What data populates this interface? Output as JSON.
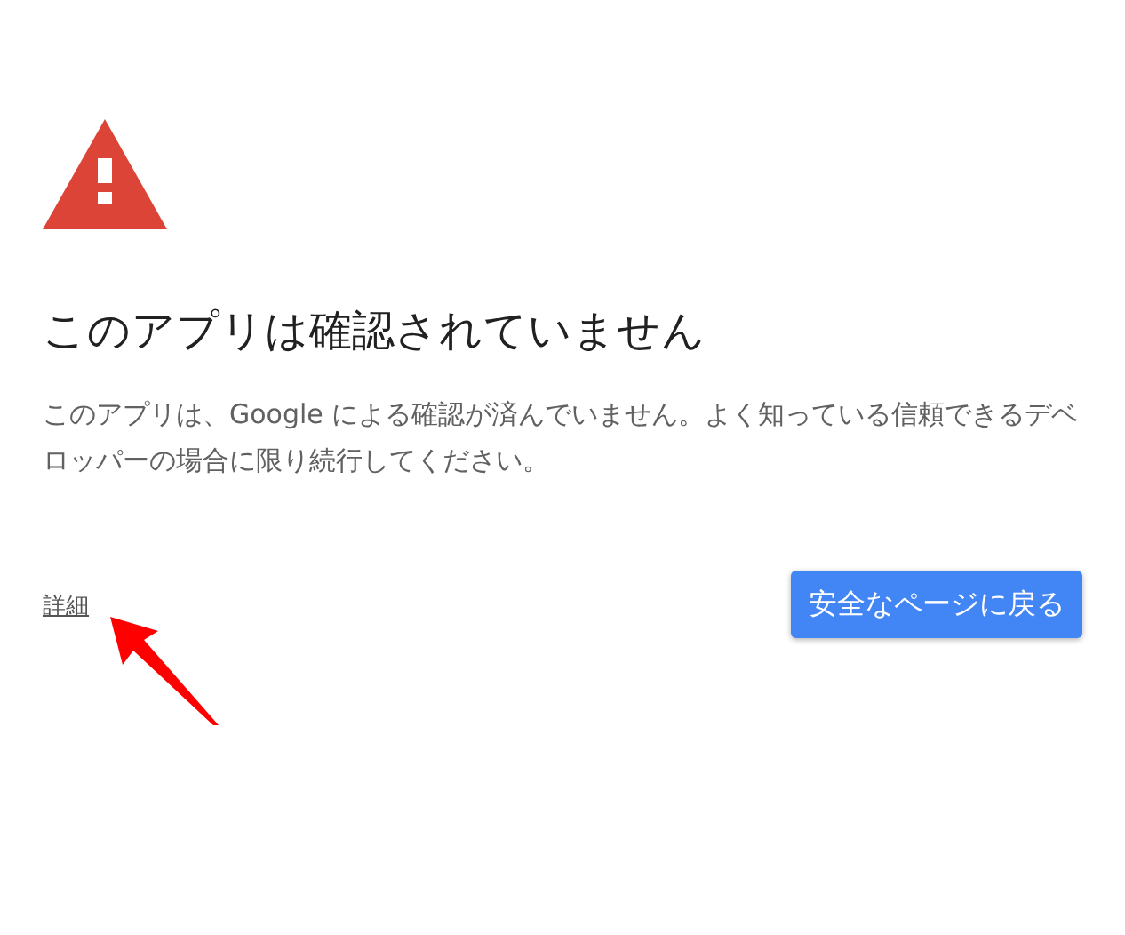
{
  "title": "このアプリは確認されていません",
  "message": "このアプリは、Google による確認が済んでいません。よく知っている信頼できるデベロッパーの場合に限り続行してください。",
  "details_link": "詳細",
  "back_button": "安全なページに戻る"
}
